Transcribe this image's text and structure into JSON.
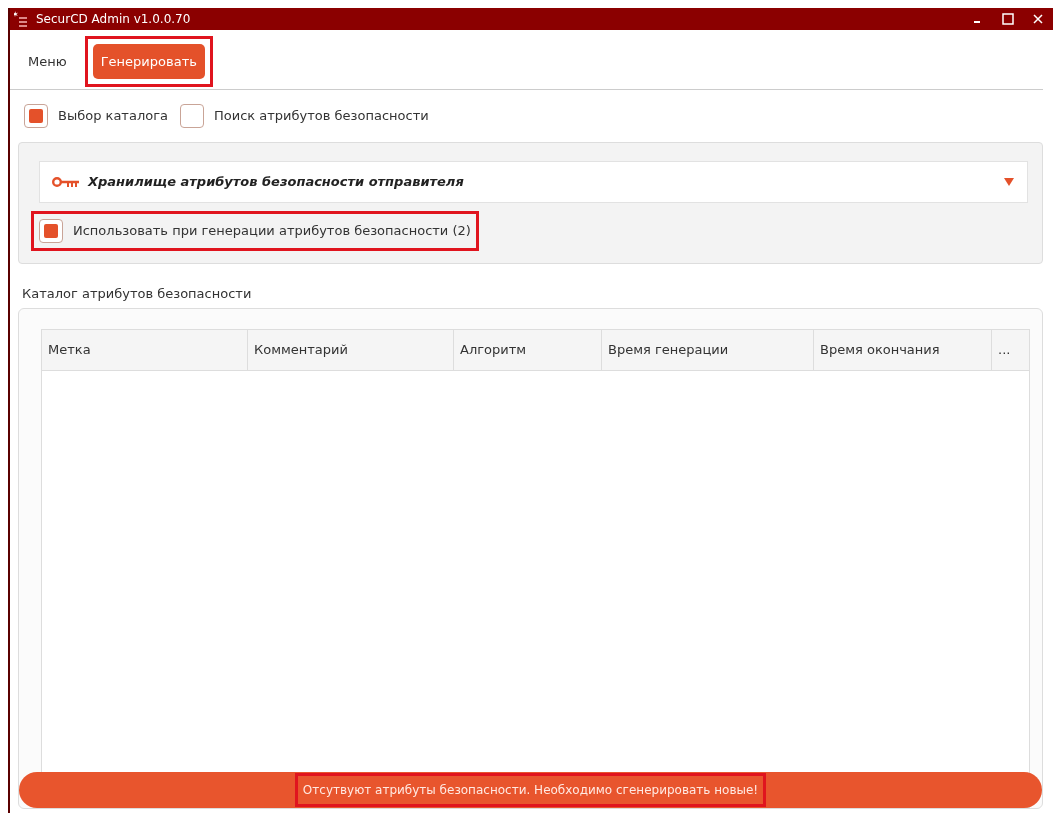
{
  "window": {
    "title": "SecurCD Admin v1.0.0.70"
  },
  "tabs": [
    {
      "label": "Меню",
      "selected": false,
      "highlighted": false
    },
    {
      "label": "Генерировать",
      "selected": true,
      "highlighted": true
    }
  ],
  "modes": [
    {
      "label": "Выбор каталога",
      "selected": true
    },
    {
      "label": "Поиск атрибутов безопасности",
      "selected": false
    }
  ],
  "storage": {
    "title": "Хранилище атрибутов безопасности отправителя",
    "expanded": false
  },
  "use_checkbox": {
    "label": "Использовать при генерации атрибутов безопасности (2)",
    "checked": true,
    "highlighted": true
  },
  "catalog": {
    "title": "Каталог атрибутов безопасности",
    "columns": [
      "Метка",
      "Комментарий",
      "Алгоритм",
      "Время генерации",
      "Время окончания",
      "..."
    ]
  },
  "status_bar": {
    "text": "Отсутвуют атрибуты безопасности. Необходимо сгенерировать новые!",
    "highlighted": true
  }
}
